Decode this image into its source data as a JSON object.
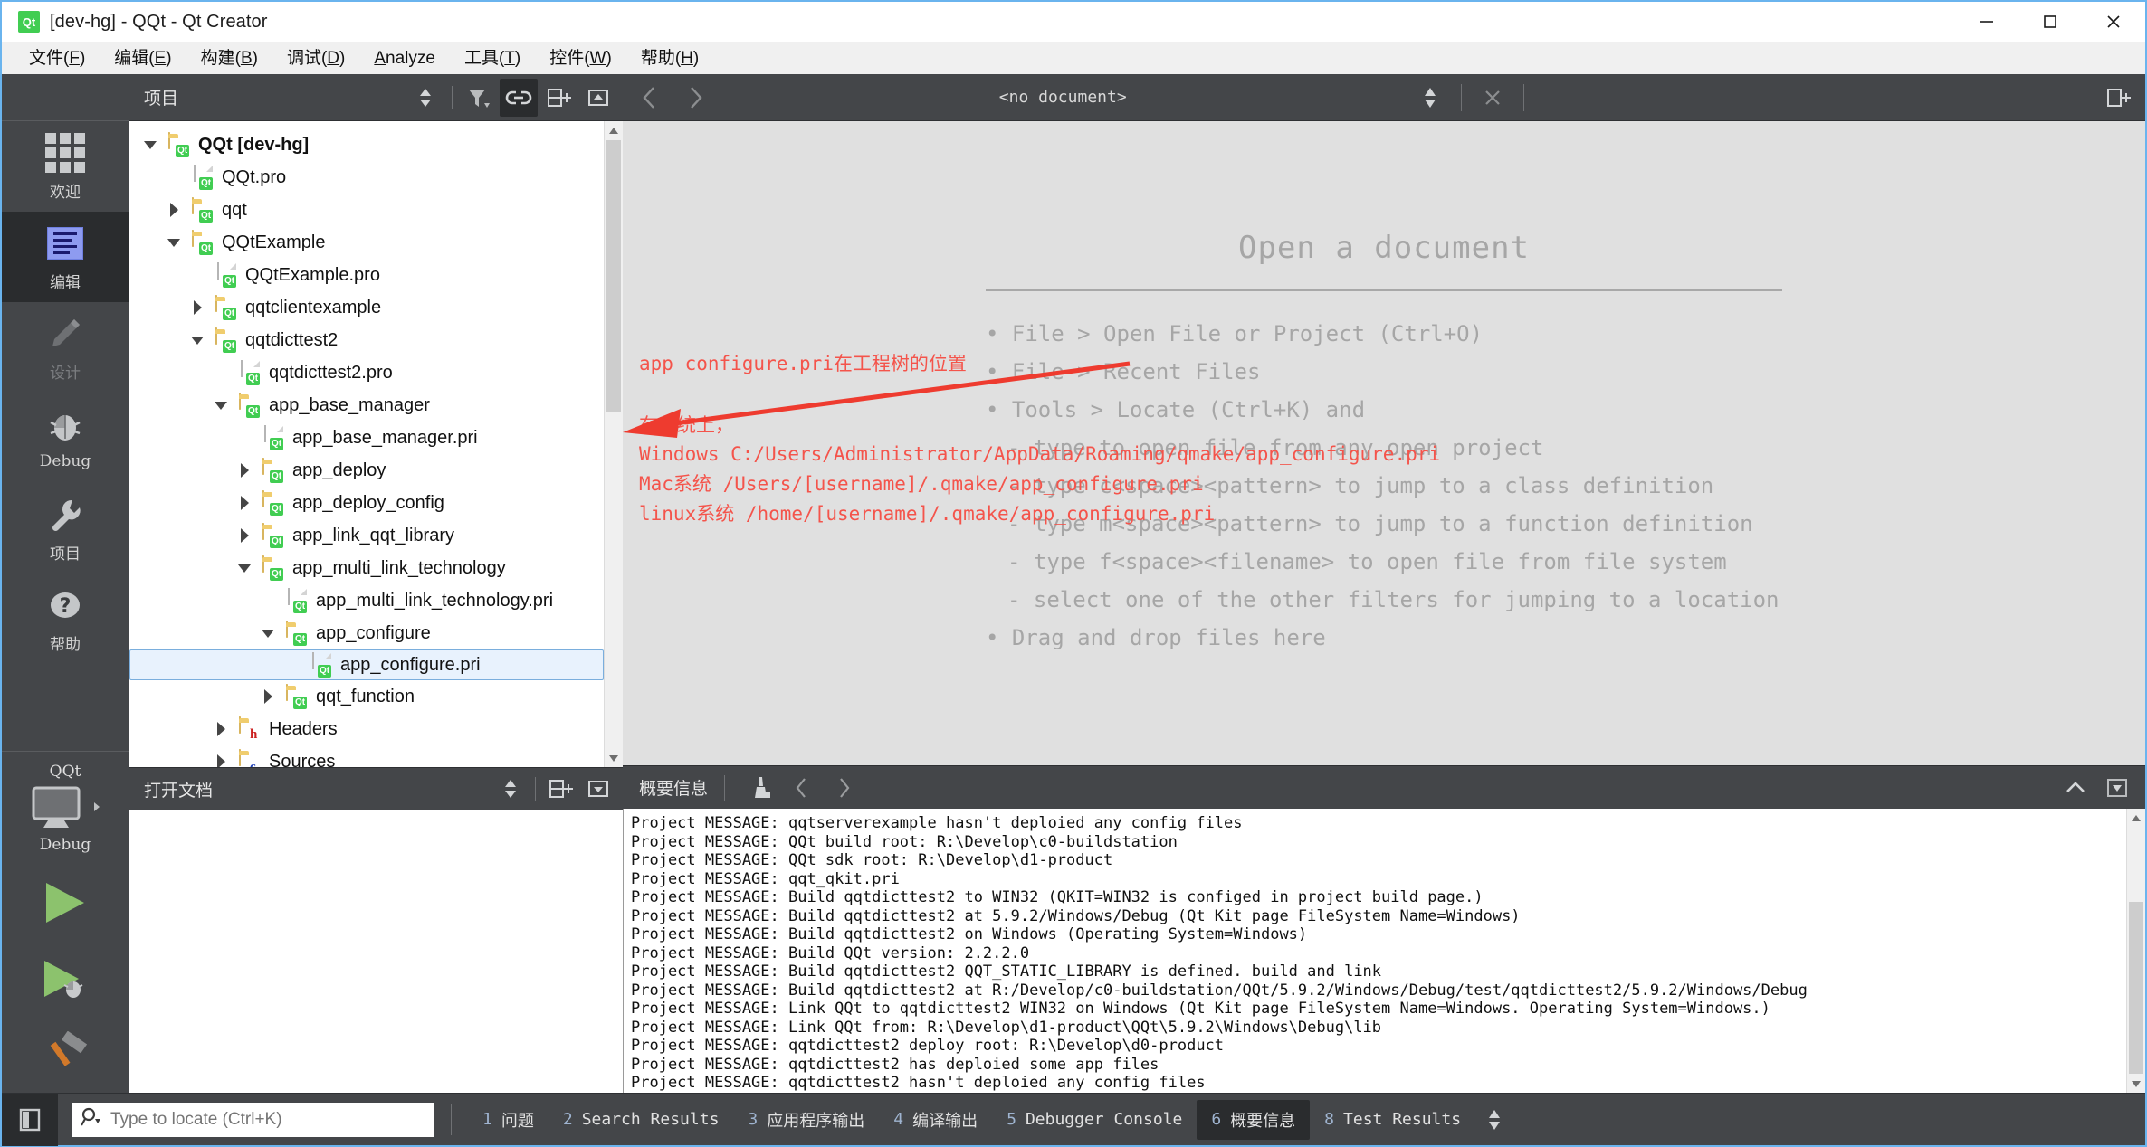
{
  "window": {
    "title": "[dev-hg] - QQt - Qt Creator",
    "logo_text": "Qt",
    "minimize_label": "minimize",
    "maximize_label": "maximize",
    "close_label": "close"
  },
  "menubar": [
    {
      "text": "文件(F)",
      "mnemonic": "F"
    },
    {
      "text": "编辑(E)",
      "mnemonic": "E"
    },
    {
      "text": "构建(B)",
      "mnemonic": "B"
    },
    {
      "text": "调试(D)",
      "mnemonic": "D"
    },
    {
      "text": "Analyze",
      "mnemonic": "A"
    },
    {
      "text": "工具(T)",
      "mnemonic": "T"
    },
    {
      "text": "控件(W)",
      "mnemonic": "W"
    },
    {
      "text": "帮助(H)",
      "mnemonic": "H"
    }
  ],
  "modebar": {
    "items": [
      {
        "label": "欢迎",
        "icon": "grid-icon",
        "state": "normal"
      },
      {
        "label": "编辑",
        "icon": "document-lines-icon",
        "state": "active"
      },
      {
        "label": "设计",
        "icon": "pencil-icon",
        "state": "disabled"
      },
      {
        "label": "Debug",
        "icon": "bug-icon",
        "state": "normal"
      },
      {
        "label": "项目",
        "icon": "wrench-icon",
        "state": "normal"
      },
      {
        "label": "帮助",
        "icon": "question-mark-icon",
        "state": "normal"
      }
    ],
    "kit": {
      "project_name": "QQt",
      "build_config": "Debug",
      "target_icon": "monitor-icon"
    },
    "run_button": "run-icon",
    "debug_button": "debug-run-icon",
    "build_button": "hammer-icon"
  },
  "sidebar": {
    "title": "项目",
    "buttons": [
      {
        "name": "combo-arrows-icon",
        "active": false
      },
      {
        "name": "filter-icon",
        "active": false
      },
      {
        "name": "link-icon",
        "active": true
      },
      {
        "name": "split-icon",
        "active": false
      },
      {
        "name": "close-split-icon",
        "active": false
      }
    ],
    "tree": [
      {
        "label": "QQt [dev-hg]",
        "indent": 0,
        "twist": "down",
        "icon": "qt-folder",
        "bold": true,
        "selected": false
      },
      {
        "label": "QQt.pro",
        "indent": 1,
        "twist": "none",
        "icon": "qt-file",
        "bold": false,
        "selected": false
      },
      {
        "label": "qqt",
        "indent": 1,
        "twist": "right",
        "icon": "qt-folder",
        "bold": false,
        "selected": false
      },
      {
        "label": "QQtExample",
        "indent": 1,
        "twist": "down",
        "icon": "qt-folder",
        "bold": false,
        "selected": false
      },
      {
        "label": "QQtExample.pro",
        "indent": 2,
        "twist": "none",
        "icon": "qt-file",
        "bold": false,
        "selected": false
      },
      {
        "label": "qqtclientexample",
        "indent": 2,
        "twist": "right",
        "icon": "qt-folder",
        "bold": false,
        "selected": false
      },
      {
        "label": "qqtdicttest2",
        "indent": 2,
        "twist": "down",
        "icon": "qt-folder",
        "bold": false,
        "selected": false
      },
      {
        "label": "qqtdicttest2.pro",
        "indent": 3,
        "twist": "none",
        "icon": "qt-file",
        "bold": false,
        "selected": false
      },
      {
        "label": "app_base_manager",
        "indent": 3,
        "twist": "down",
        "icon": "qt-folder",
        "bold": false,
        "selected": false
      },
      {
        "label": "app_base_manager.pri",
        "indent": 4,
        "twist": "none",
        "icon": "qt-file",
        "bold": false,
        "selected": false
      },
      {
        "label": "app_deploy",
        "indent": 4,
        "twist": "right",
        "icon": "qt-folder",
        "bold": false,
        "selected": false
      },
      {
        "label": "app_deploy_config",
        "indent": 4,
        "twist": "right",
        "icon": "qt-folder",
        "bold": false,
        "selected": false
      },
      {
        "label": "app_link_qqt_library",
        "indent": 4,
        "twist": "right",
        "icon": "qt-folder",
        "bold": false,
        "selected": false
      },
      {
        "label": "app_multi_link_technology",
        "indent": 4,
        "twist": "down",
        "icon": "qt-folder",
        "bold": false,
        "selected": false
      },
      {
        "label": "app_multi_link_technology.pri",
        "indent": 5,
        "twist": "none",
        "icon": "qt-file",
        "bold": false,
        "selected": false
      },
      {
        "label": "app_configure",
        "indent": 5,
        "twist": "down",
        "icon": "qt-folder",
        "bold": false,
        "selected": false
      },
      {
        "label": "app_configure.pri",
        "indent": 6,
        "twist": "none",
        "icon": "qt-file",
        "bold": false,
        "selected": true
      },
      {
        "label": "qqt_function",
        "indent": 5,
        "twist": "right",
        "icon": "qt-folder",
        "bold": false,
        "selected": false
      },
      {
        "label": "Headers",
        "indent": 3,
        "twist": "right",
        "icon": "h-folder",
        "bold": false,
        "selected": false
      },
      {
        "label": "Sources",
        "indent": 3,
        "twist": "right",
        "icon": "c-folder",
        "bold": false,
        "selected": false
      }
    ],
    "open_documents": {
      "title": "打开文档",
      "buttons": [
        {
          "name": "combo-arrows-icon"
        },
        {
          "name": "split-icon"
        },
        {
          "name": "close-split-icon"
        }
      ]
    }
  },
  "editor": {
    "toolbar": {
      "back": "back-arrow-icon",
      "forward": "forward-arrow-icon",
      "document_title": "<no document>",
      "combo": "combo-arrows-icon",
      "close": "close-icon",
      "split_right": "split-icon"
    },
    "placeholder": {
      "title": "Open a document",
      "items": [
        {
          "text": "• File > Open File or Project (Ctrl+O)",
          "sub": false
        },
        {
          "text": "• File > Recent Files",
          "sub": false
        },
        {
          "text": "• Tools > Locate (Ctrl+K) and",
          "sub": false
        },
        {
          "text": "- type to open file from any open project",
          "sub": true
        },
        {
          "text": "- type c<space><pattern> to jump to a class definition",
          "sub": true
        },
        {
          "text": "- type m<space><pattern> to jump to a function definition",
          "sub": true
        },
        {
          "text": "- type f<space><filename> to open file from file system",
          "sub": true
        },
        {
          "text": "- select one of the other filters for jumping to a location",
          "sub": true
        },
        {
          "text": "• Drag and drop files here",
          "sub": false
        }
      ]
    },
    "annotations": {
      "color": "#f4544b",
      "tree_note": "app_configure.pri在工程树的位置",
      "system_heading": "在系统上，",
      "paths": [
        "Windows C:/Users/Administrator/AppData/Roaming/qmake/app_configure.pri",
        "Mac系统 /Users/[username]/.qmake/app_configure.pri",
        "linux系统 /home/[username]/.qmake/app_configure.pri"
      ]
    }
  },
  "output_pane": {
    "title": "概要信息",
    "buttons": [
      {
        "name": "clear-broom-icon"
      },
      {
        "name": "prev-item-icon"
      },
      {
        "name": "next-item-icon"
      },
      {
        "name": "collapse-icon"
      },
      {
        "name": "maximize-pane-icon"
      }
    ],
    "lines": [
      "Project MESSAGE: qqtserverexample hasn't deploied any config files",
      "Project MESSAGE: QQt build root: R:\\Develop\\c0-buildstation",
      "Project MESSAGE: QQt sdk root: R:\\Develop\\d1-product",
      "Project MESSAGE: qqt_qkit.pri",
      "Project MESSAGE: Build qqtdicttest2 to WIN32 (QKIT=WIN32 is configed in project build page.)",
      "Project MESSAGE: Build qqtdicttest2 at 5.9.2/Windows/Debug (Qt Kit page FileSystem Name=Windows)",
      "Project MESSAGE: Build qqtdicttest2 on Windows (Operating System=Windows)",
      "Project MESSAGE: Build QQt version: 2.2.2.0",
      "Project MESSAGE: Build qqtdicttest2 QQT_STATIC_LIBRARY is defined. build and link",
      "Project MESSAGE: Build qqtdicttest2 at R:/Develop/c0-buildstation/QQt/5.9.2/Windows/Debug/test/qqtdicttest2/5.9.2/Windows/Debug",
      "Project MESSAGE: Link QQt to qqtdicttest2 WIN32 on Windows (Qt Kit page FileSystem Name=Windows. Operating System=Windows.)",
      "Project MESSAGE: Link QQt from: R:\\Develop\\d1-product\\QQt\\5.9.2\\Windows\\Debug\\lib",
      "Project MESSAGE: qqtdicttest2 deploy root: R:\\Develop\\d0-product",
      "Project MESSAGE: qqtdicttest2 has deploied some app files",
      "Project MESSAGE: qqtdicttest2 hasn't deploied any config files"
    ]
  },
  "statusbar": {
    "sidebar_toggle": "sidebar-toggle-icon",
    "locator": {
      "icon": "search-icon",
      "placeholder": "Type to locate (Ctrl+K)",
      "value": ""
    },
    "tabs": [
      {
        "num": "1",
        "name": "问题",
        "active": false
      },
      {
        "num": "2",
        "name": "Search Results",
        "active": false
      },
      {
        "num": "3",
        "name": "应用程序输出",
        "active": false
      },
      {
        "num": "4",
        "name": "编译输出",
        "active": false
      },
      {
        "num": "5",
        "name": "Debugger Console",
        "active": false
      },
      {
        "num": "6",
        "name": "概要信息",
        "active": true
      },
      {
        "num": "8",
        "name": "Test Results",
        "active": false
      }
    ],
    "scroll_icon": "combo-arrows-icon"
  }
}
